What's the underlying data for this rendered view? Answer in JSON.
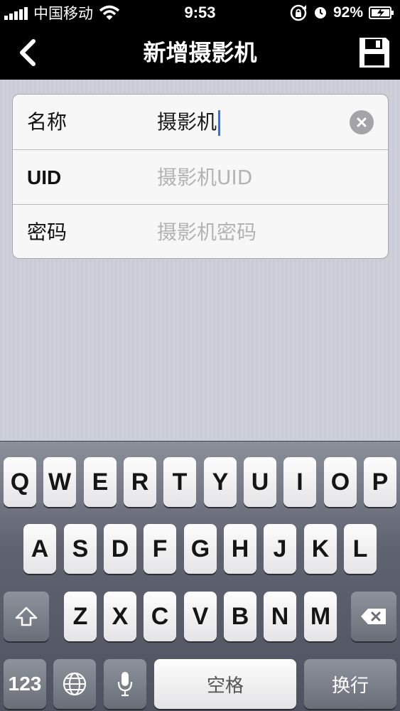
{
  "status_bar": {
    "carrier": "中国移动",
    "time": "9:53",
    "battery_percent": "92%"
  },
  "nav": {
    "title": "新增摄影机",
    "back_icon": "chevron-left-icon",
    "save_icon": "floppy-save-icon"
  },
  "form": {
    "rows": [
      {
        "label": "名称",
        "value": "摄影机",
        "placeholder": ""
      },
      {
        "label": "UID",
        "value": "",
        "placeholder": "摄影机UID"
      },
      {
        "label": "密码",
        "value": "",
        "placeholder": "摄影机密码"
      }
    ]
  },
  "keyboard": {
    "row1": [
      "Q",
      "W",
      "E",
      "R",
      "T",
      "Y",
      "U",
      "I",
      "O",
      "P"
    ],
    "row2": [
      "A",
      "S",
      "D",
      "F",
      "G",
      "H",
      "J",
      "K",
      "L"
    ],
    "row3": [
      "Z",
      "X",
      "C",
      "V",
      "B",
      "N",
      "M"
    ],
    "numbers_label": "123",
    "space_label": "空格",
    "return_label": "换行"
  },
  "colors": {
    "caret": "#3e6de0",
    "nav_bg": "#000000"
  }
}
